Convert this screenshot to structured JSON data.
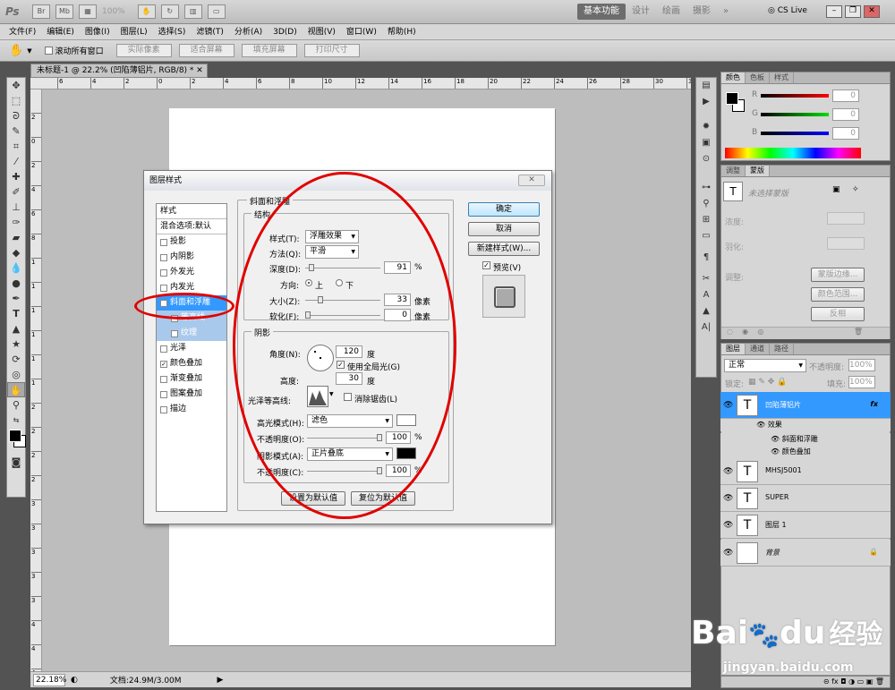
{
  "app": {
    "logo": "Ps",
    "zoom": "100%",
    "workspaces": [
      "基本功能",
      "设计",
      "绘画",
      "摄影"
    ],
    "more": "»",
    "cslive": "CS Live"
  },
  "menu": [
    "文件(F)",
    "编辑(E)",
    "图像(I)",
    "图层(L)",
    "选择(S)",
    "滤镜(T)",
    "分析(A)",
    "3D(D)",
    "视图(V)",
    "窗口(W)",
    "帮助(H)"
  ],
  "options": {
    "scroll_all": "滚动所有窗口",
    "actual_pixels": "实际像素",
    "fit_screen": "适合屏幕",
    "fill_screen": "填充屏幕",
    "print_size": "打印尺寸"
  },
  "document": {
    "tab_title": "未标题-1 @ 22.2% (凹陷薄铝片, RGB/8) *",
    "zoom": "22.18%",
    "doc_info": "文档:24.9M/3.00M",
    "ruler_h": [
      "6",
      "4",
      "2",
      "0",
      "2",
      "4",
      "6",
      "8",
      "10",
      "12",
      "14",
      "16",
      "18",
      "20",
      "22",
      "24",
      "26",
      "28",
      "30",
      "32"
    ],
    "ruler_v": [
      "2",
      "0",
      "2",
      "4",
      "6",
      "8",
      "1",
      "1",
      "1",
      "1",
      "1",
      "1",
      "2",
      "2",
      "2",
      "2",
      "3",
      "3",
      "3",
      "3",
      "3",
      "4",
      "4",
      "4"
    ]
  },
  "dialog": {
    "title": "图层样式",
    "ok": "确定",
    "cancel": "取消",
    "new_style": "新建样式(W)...",
    "preview": "预览(V)",
    "styles_header": "样式",
    "blend_options": "混合选项:默认",
    "styles": [
      {
        "label": "投影",
        "checked": false
      },
      {
        "label": "内阴影",
        "checked": false
      },
      {
        "label": "外发光",
        "checked": false
      },
      {
        "label": "内发光",
        "checked": false
      },
      {
        "label": "斜面和浮雕",
        "checked": true,
        "selected": true
      },
      {
        "label": "等高线",
        "checked": false,
        "sub": true
      },
      {
        "label": "纹理",
        "checked": false,
        "sub": true
      },
      {
        "label": "光泽",
        "checked": false
      },
      {
        "label": "颜色叠加",
        "checked": true
      },
      {
        "label": "渐变叠加",
        "checked": false
      },
      {
        "label": "图案叠加",
        "checked": false
      },
      {
        "label": "描边",
        "checked": false
      }
    ],
    "section_title": "斜面和浮雕",
    "structure": "结构",
    "style_label": "样式(T):",
    "style_value": "浮雕效果",
    "method_label": "方法(Q):",
    "method_value": "平滑",
    "depth_label": "深度(D):",
    "depth_value": "91",
    "pct": "%",
    "direction_label": "方向:",
    "dir_up": "上",
    "dir_down": "下",
    "size_label": "大小(Z):",
    "size_value": "33",
    "px": "像素",
    "soften_label": "软化(F):",
    "soften_value": "0",
    "shading": "阴影",
    "angle_label": "角度(N):",
    "angle_value": "120",
    "deg": "度",
    "global_light": "使用全局光(G)",
    "altitude_label": "高度:",
    "altitude_value": "30",
    "gloss_label": "光泽等高线:",
    "antialias": "消除锯齿(L)",
    "highlight_mode_label": "高光模式(H):",
    "highlight_mode": "滤色",
    "opacity_label": "不透明度(O):",
    "opacity_value": "100",
    "shadow_mode_label": "阴影模式(A):",
    "shadow_mode": "正片叠底",
    "opacity2_label": "不透明度(C):",
    "opacity2_value": "100",
    "set_default": "设置为默认值",
    "reset_default": "复位为默认值"
  },
  "color_panel": {
    "tabs": [
      "颜色",
      "色板",
      "样式"
    ],
    "r": "0",
    "g": "0",
    "b": "0",
    "r_label": "R",
    "g_label": "G",
    "b_label": "B"
  },
  "adjust_panel": {
    "tabs": [
      "调整",
      "蒙版"
    ],
    "mask_title": "未选择蒙版",
    "density": "浓度:",
    "feather": "羽化:",
    "refine": "调整:",
    "mask_edge": "蒙版边缘...",
    "color_range": "颜色范围...",
    "invert": "反相"
  },
  "layers_panel": {
    "tabs": [
      "图层",
      "通道",
      "路径"
    ],
    "blend": "正常",
    "opacity_label": "不透明度:",
    "opacity": "100%",
    "lock_label": "锁定:",
    "fill_label": "填充:",
    "fill": "100%",
    "layers": [
      {
        "name": "凹陷薄铝片",
        "type": "T",
        "selected": true,
        "fx": "fx"
      },
      {
        "name": "MHSJ5001",
        "type": "T"
      },
      {
        "name": "SUPER",
        "type": "T"
      },
      {
        "name": "图层 1",
        "type": "T"
      },
      {
        "name": "背景",
        "type": ""
      }
    ],
    "effects": "效果",
    "effect1": "斜面和浮雕",
    "effect2": "颜色叠加"
  },
  "watermark": {
    "brand": "Bai",
    "paw": "🐾",
    "du": "du",
    "cn": "经验",
    "url": "jingyan.baidu.com"
  },
  "colors": {
    "accent": "#3399ff",
    "annotation": "#e00000"
  }
}
